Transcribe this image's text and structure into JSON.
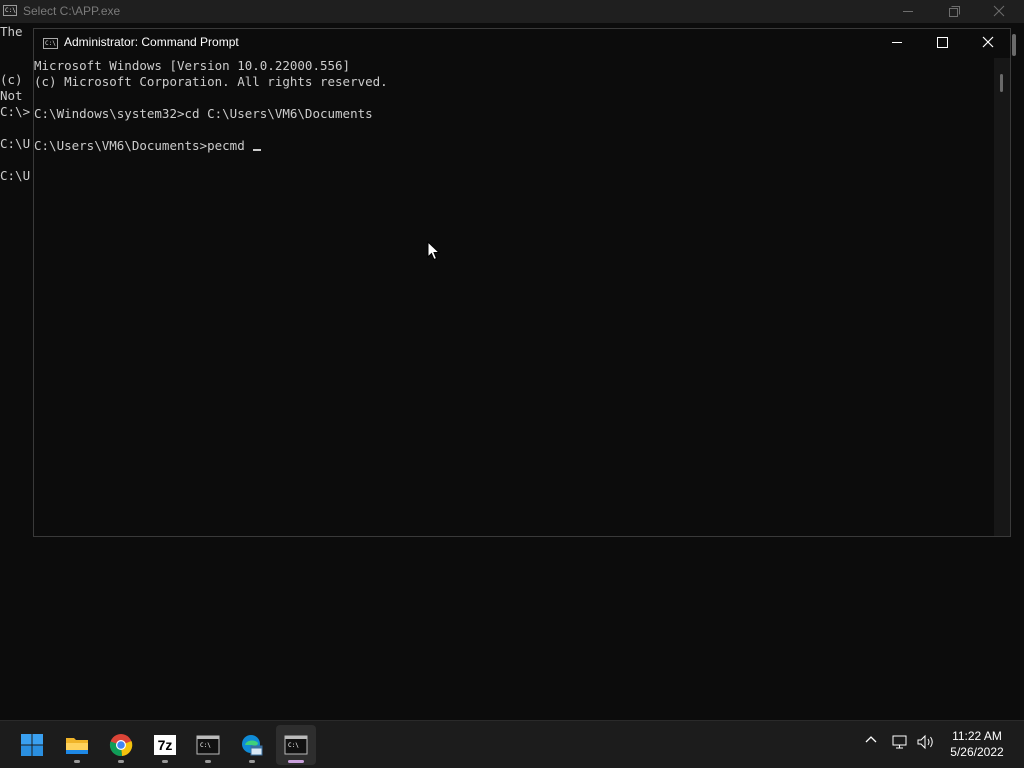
{
  "background_window": {
    "title": "Select C:\\APP.exe",
    "icon_text": "C:\\",
    "lines": [
      "The",
      "",
      "(c)",
      "Not",
      "",
      "C:\\>",
      "",
      "C:\\U",
      "",
      "C:\\U"
    ],
    "controls": {
      "minimize": "—",
      "maximize": "❐",
      "close": "✕"
    }
  },
  "foreground_window": {
    "title": "Administrator: Command Prompt",
    "icon_text": "C:\\",
    "lines": [
      "Microsoft Windows [Version 10.0.22000.556]",
      "(c) Microsoft Corporation. All rights reserved.",
      "",
      "C:\\Windows\\system32>cd C:\\Users\\VM6\\Documents",
      "",
      "C:\\Users\\VM6\\Documents>pecmd "
    ]
  },
  "taskbar": {
    "apps": [
      {
        "name": "start",
        "icon": "windows-logo-icon"
      },
      {
        "name": "file-explorer",
        "icon": "folder-icon"
      },
      {
        "name": "chrome",
        "icon": "chrome-icon"
      },
      {
        "name": "7-zip",
        "icon": "7zip-icon",
        "label": "7z"
      },
      {
        "name": "command-prompt",
        "icon": "terminal-icon"
      },
      {
        "name": "edge-app",
        "icon": "edge-icon"
      },
      {
        "name": "command-prompt-admin",
        "icon": "terminal-icon",
        "active": true
      }
    ],
    "tray": {
      "chevron": "^",
      "time": "11:22 AM",
      "date": "5/26/2022"
    }
  }
}
